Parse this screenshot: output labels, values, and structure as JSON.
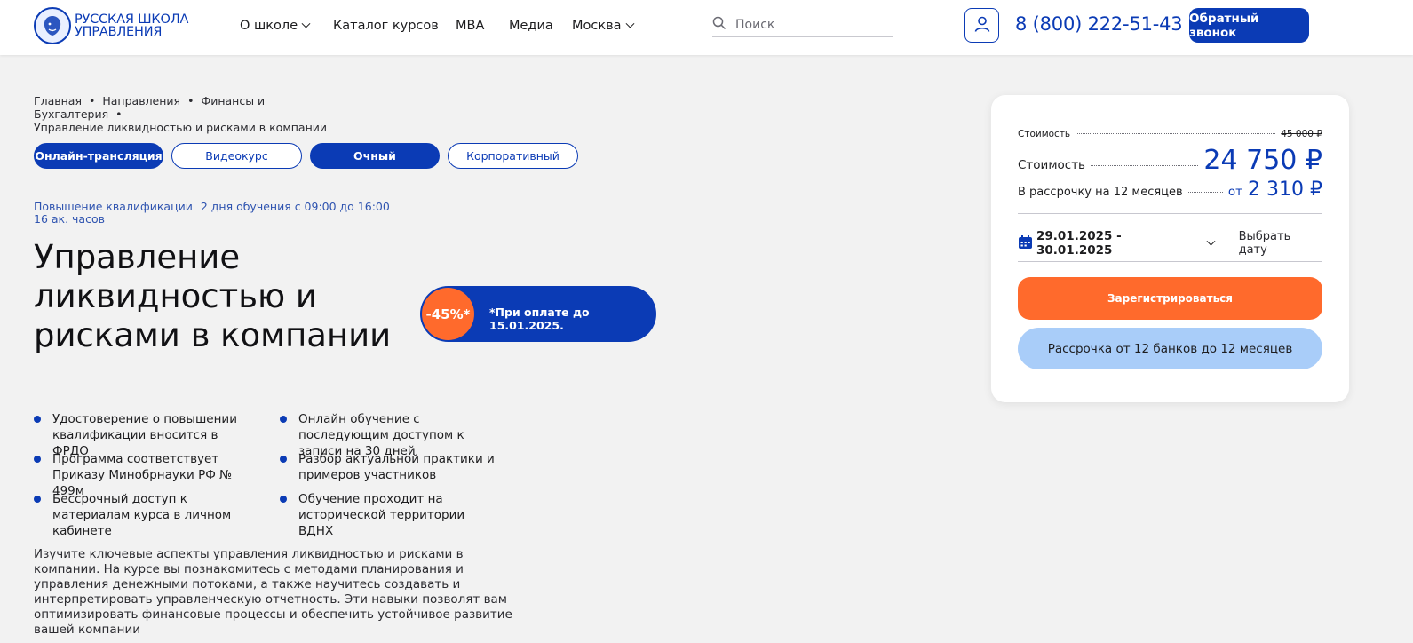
{
  "header": {
    "logo_text_line1": "Русская школа",
    "logo_text_line2": "управления",
    "nav": {
      "about": "О школе",
      "catalog": "Каталог курсов",
      "mba": "MBA",
      "media": "Медиа",
      "city": "Москва"
    },
    "search_placeholder": "Поиск",
    "phone": "8 (800) 222-51-43",
    "callback_label": "Обратный звонок"
  },
  "breadcrumbs": {
    "home": "Главная",
    "directions": "Направления",
    "finance": "Финансы и Бухгалтерия",
    "current": "Управление ликвидностью и рисками в компании"
  },
  "formats": {
    "online": "Онлайн-трансляция",
    "video": "Видеокурс",
    "offline": "Очный",
    "corporate": "Корпоративный"
  },
  "meta": {
    "type": "Повышение квалификации",
    "schedule": "2 дня обучения с 09:00 до 16:00",
    "hours": "16 ак. часов"
  },
  "title": "Управление ликвидностью и рисками в компании",
  "promo": {
    "discount": "-45%*",
    "note": "*При оплате до 15.01.2025."
  },
  "features": [
    "Удостоверение о повышении квалификации вносится в ФРДО",
    "Онлайн обучение с последующим доступом к записи на 30 дней",
    "Программа соответствует Приказу Минобрнауки РФ № 499м",
    "Разбор актуальной практики и примеров участников",
    "Бессрочный доступ к материалам курса в личном кабинете",
    "Обучение проходит на исторической территории ВДНХ"
  ],
  "description": "Изучите ключевые аспекты управления ликвидностью и рисками в компании. На курсе вы познакомитесь с методами планирования и управления денежными потоками, а также научитесь создавать и интерпретировать управленческую отчетность. Эти навыки позволят вам оптимизировать финансовые процессы и обеспечить устойчивое развитие вашей компании",
  "pricing": {
    "old_label": "Стоимость",
    "old_price": "45 000 ₽",
    "price_label": "Стоимость",
    "price": "24 750 ₽",
    "installment_label": "В рассрочку на 12 месяцев",
    "installment_prefix": "от",
    "installment_price": "2 310 ₽",
    "dates": "29.01.2025 - 30.01.2025",
    "choose_date": "Выбрать дату",
    "register_label": "Зарегистрироваться",
    "installment_button": "Рассрочка от 12 банков до 12 месяцев"
  },
  "colors": {
    "brand_blue": "#0b3bb5",
    "accent_orange": "#ff6a2c",
    "light_blue": "#a9cdf9",
    "background": "#f2f2f2"
  }
}
